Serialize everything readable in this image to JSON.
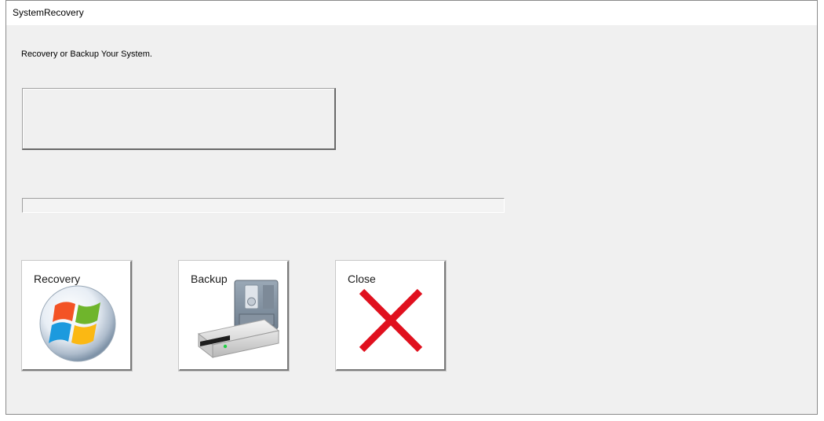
{
  "window": {
    "title": "SystemRecovery"
  },
  "main": {
    "instruction": "Recovery or Backup Your System.",
    "status_text": "",
    "progress_fraction": 0
  },
  "buttons": {
    "recovery_label": "Recovery",
    "backup_label": "Backup",
    "close_label": "Close"
  },
  "icons": {
    "recovery": "windows-logo-icon",
    "backup": "hard-drive-icon",
    "close": "red-x-icon"
  },
  "colors": {
    "window_bg": "#f0f0f0",
    "titlebar_bg": "#ffffff",
    "close_x": "#e0101e"
  }
}
